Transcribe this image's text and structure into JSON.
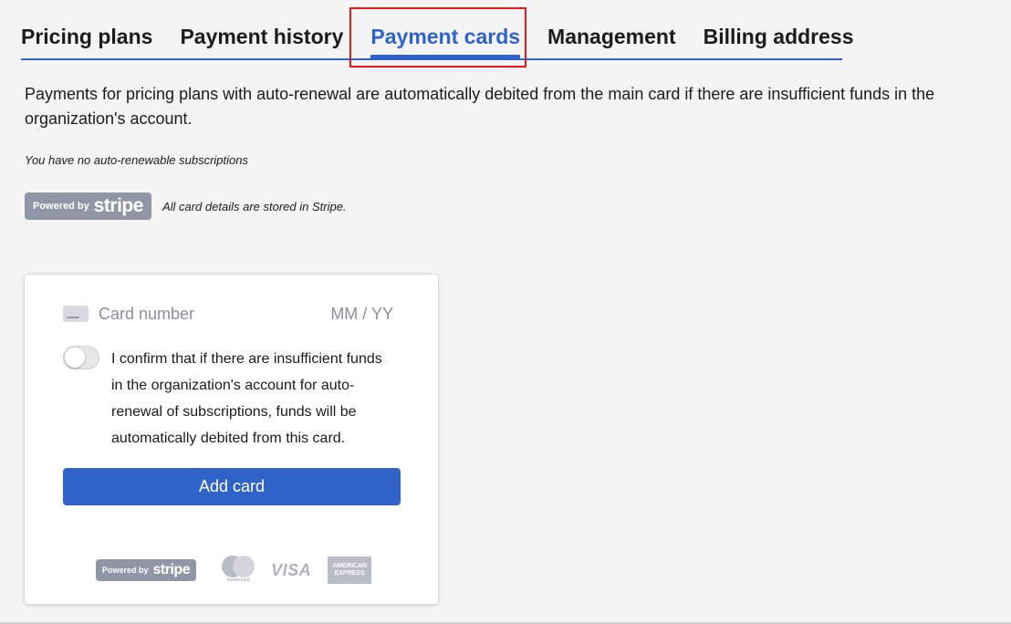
{
  "tabs": [
    {
      "label": "Pricing plans",
      "active": false
    },
    {
      "label": "Payment history",
      "active": false
    },
    {
      "label": "Payment cards",
      "active": true
    },
    {
      "label": "Management",
      "active": false
    },
    {
      "label": "Billing address",
      "active": false
    }
  ],
  "description": "Payments for pricing plans with auto-renewal are automatically debited from the main card if there are insufficient funds in the organization's account.",
  "no_subscriptions": "You have no auto-renewable subscriptions",
  "stripe": {
    "powered_by": "Powered by",
    "brand": "stripe",
    "note": "All card details are stored in Stripe."
  },
  "card_form": {
    "card_number_placeholder": "Card number",
    "expiry_placeholder": "MM / YY",
    "toggle_on": false,
    "confirm_text": "I confirm that if there are insufficient funds in the organization's account for auto-renewal of subscriptions, funds will be automatically debited from this card.",
    "add_card_label": "Add card"
  },
  "logos": {
    "mastercard_label": "mastercard",
    "visa_label": "VISA",
    "amex_line1": "AMERICAN",
    "amex_line2": "EXPRESS"
  },
  "colors": {
    "accent": "#2f63c9",
    "highlight": "#e31b1b",
    "stripe_badge": "#9196a6"
  }
}
